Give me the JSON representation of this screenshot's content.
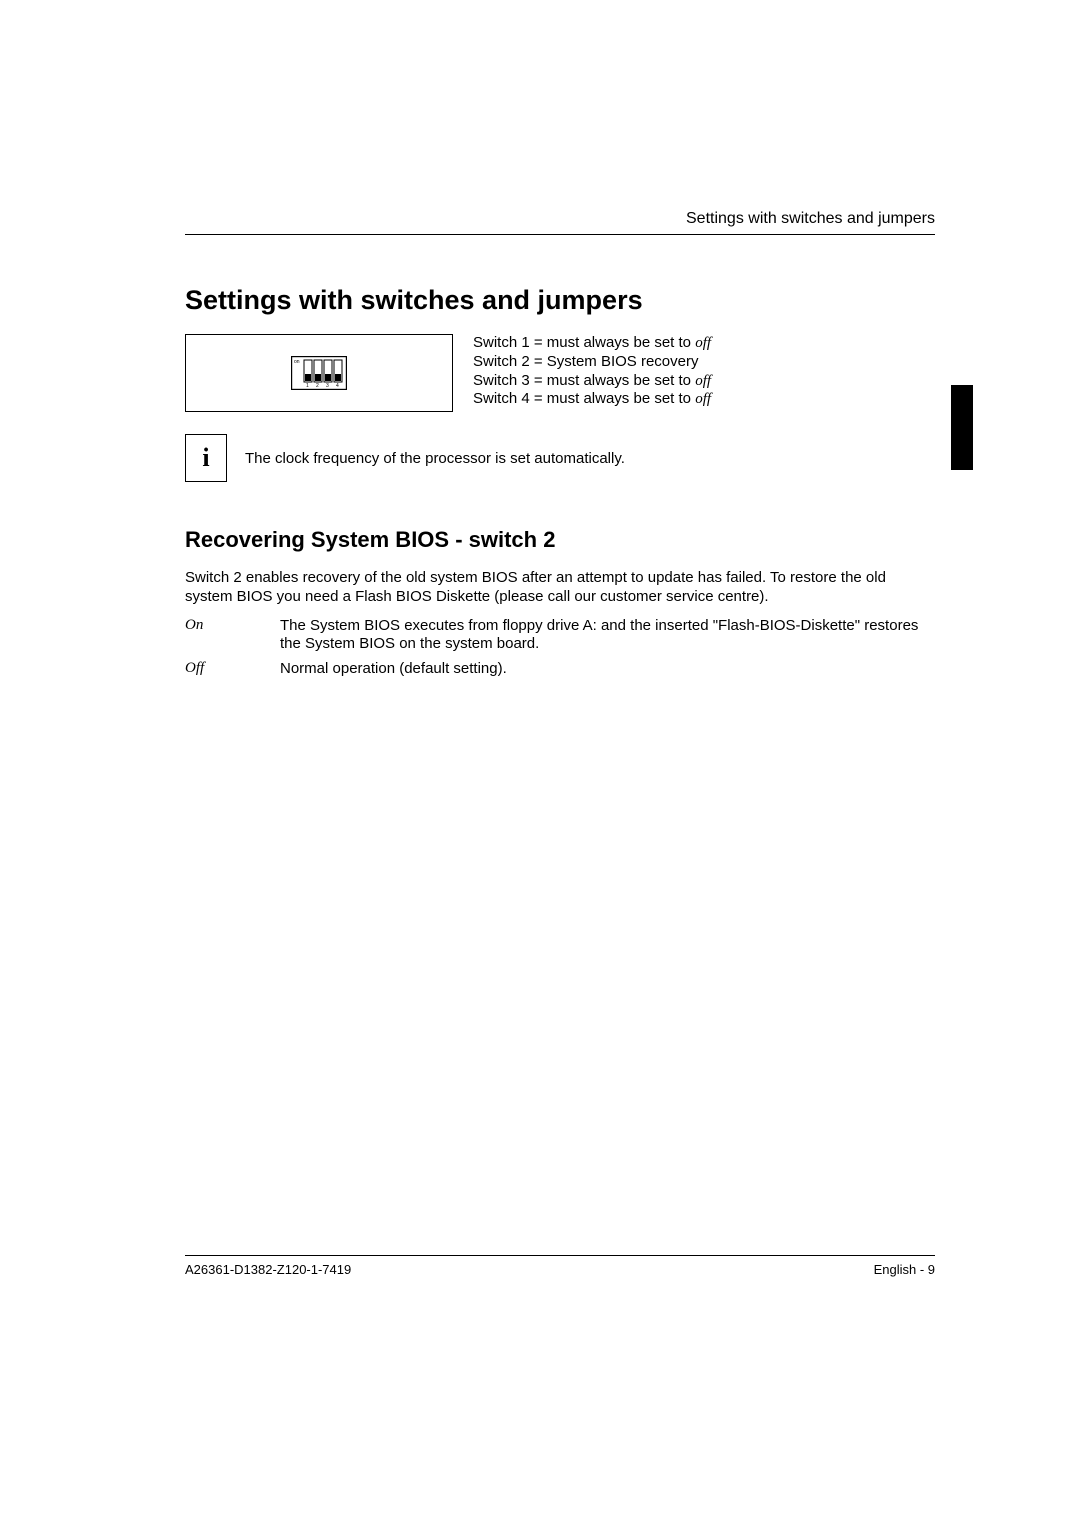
{
  "runningHeader": "Settings with switches and jumpers",
  "mainHeading": "Settings with switches and jumpers",
  "dipLabel": "on",
  "dipNumbers": [
    "1",
    "2",
    "3",
    "4"
  ],
  "switches": {
    "s1_prefix": "Switch 1 = must always be set to ",
    "s1_em": "off",
    "s2": "Switch 2 = System BIOS recovery",
    "s3_prefix": "Switch 3 = must always be set to ",
    "s3_em": "off",
    "s4_prefix": "Switch 4 = must always be set to ",
    "s4_em": "off"
  },
  "noteLetter": "i",
  "noteText": "The clock frequency of the processor is set automatically.",
  "subHeading": "Recovering System BIOS - switch 2",
  "bodyPara": "Switch 2 enables recovery of the old system BIOS after an attempt to update has failed. To restore the old system BIOS you need a Flash BIOS Diskette (please call our customer service centre).",
  "defs": {
    "onLabel": "On",
    "onDesc": "The System BIOS executes from floppy drive A: and the inserted \"Flash-BIOS-Diskette\" restores the System BIOS on the system board.",
    "offLabel": "Off",
    "offDesc": "Normal operation (default setting)."
  },
  "footer": {
    "left": "A26361-D1382-Z120-1-7419",
    "right": "English - 9"
  }
}
